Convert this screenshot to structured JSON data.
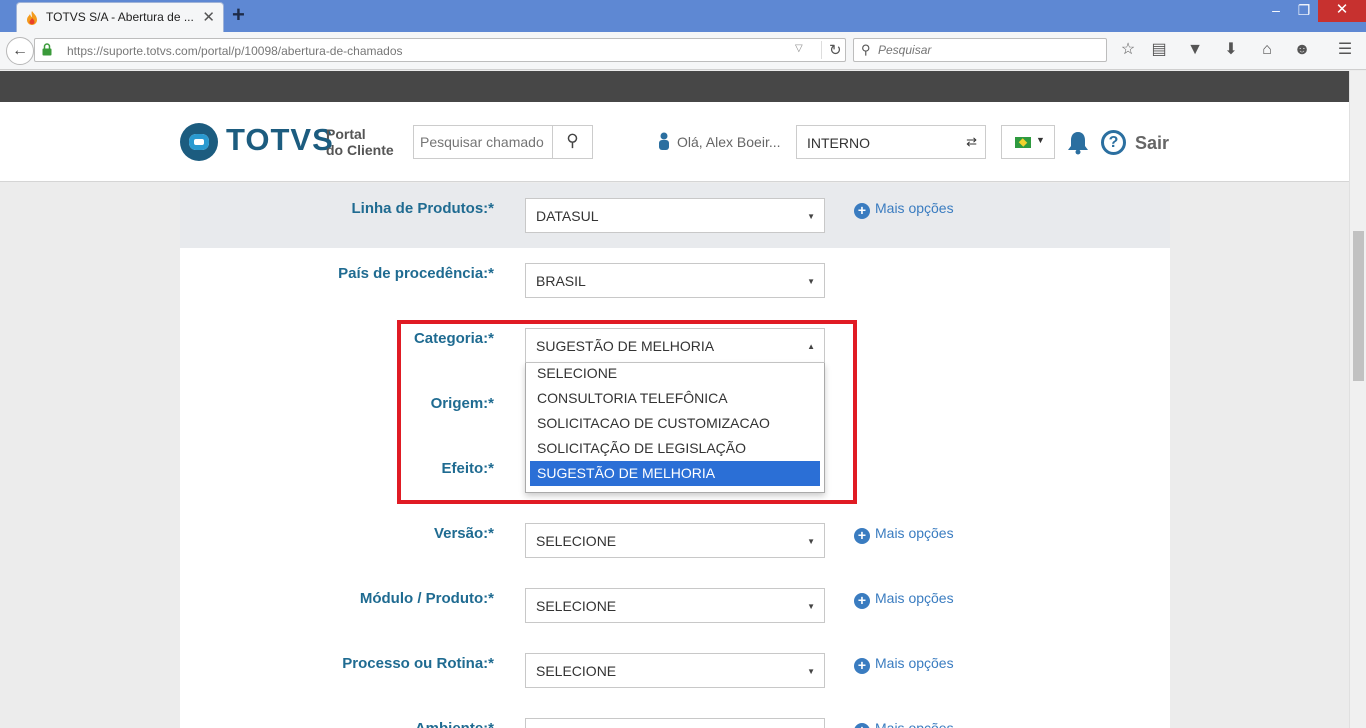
{
  "browser": {
    "tab_title": "TOTVS S/A - Abertura de ...",
    "tab_close": "✕",
    "new_tab": "+",
    "url": "https://suporte.totvs.com/portal/p/10098/abertura-de-chamados",
    "search_placeholder": "Pesquisar"
  },
  "header": {
    "logo": "TOTVS",
    "portal_line1": "Portal",
    "portal_line2": "do Cliente",
    "search_placeholder": "Pesquisar chamado",
    "greeting": "Olá, Alex Boeir...",
    "profile": "INTERNO",
    "logout": "Sair",
    "help": "?"
  },
  "form": {
    "fields": [
      {
        "label": "Linha de Produtos:*",
        "value": "DATASUL",
        "more": "Mais opções"
      },
      {
        "label": "País de procedência:*",
        "value": "BRASIL"
      },
      {
        "label": "Categoria:*",
        "value": "SUGESTÃO DE MELHORIA"
      },
      {
        "label": "Origem:*"
      },
      {
        "label": "Efeito:*"
      },
      {
        "label": "Versão:*",
        "value": "SELECIONE",
        "more": "Mais opções"
      },
      {
        "label": "Módulo / Produto:*",
        "value": "SELECIONE",
        "more": "Mais opções"
      },
      {
        "label": "Processo ou Rotina:*",
        "value": "SELECIONE",
        "more": "Mais opções"
      },
      {
        "label": "Ambiente:*",
        "more": "Mais opções"
      }
    ],
    "categoria_options": [
      "SELECIONE",
      "CONSULTORIA TELEFÔNICA",
      "SOLICITACAO DE CUSTOMIZACAO",
      "SOLICITAÇÃO DE LEGISLAÇÃO",
      "SUGESTÃO DE MELHORIA"
    ],
    "selected_option": "SUGESTÃO DE MELHORIA"
  },
  "colors": {
    "label": "#1f6b91",
    "link": "#3a7cc0",
    "highlight": "#e01b24",
    "selected_option": "#2b6fd6"
  }
}
